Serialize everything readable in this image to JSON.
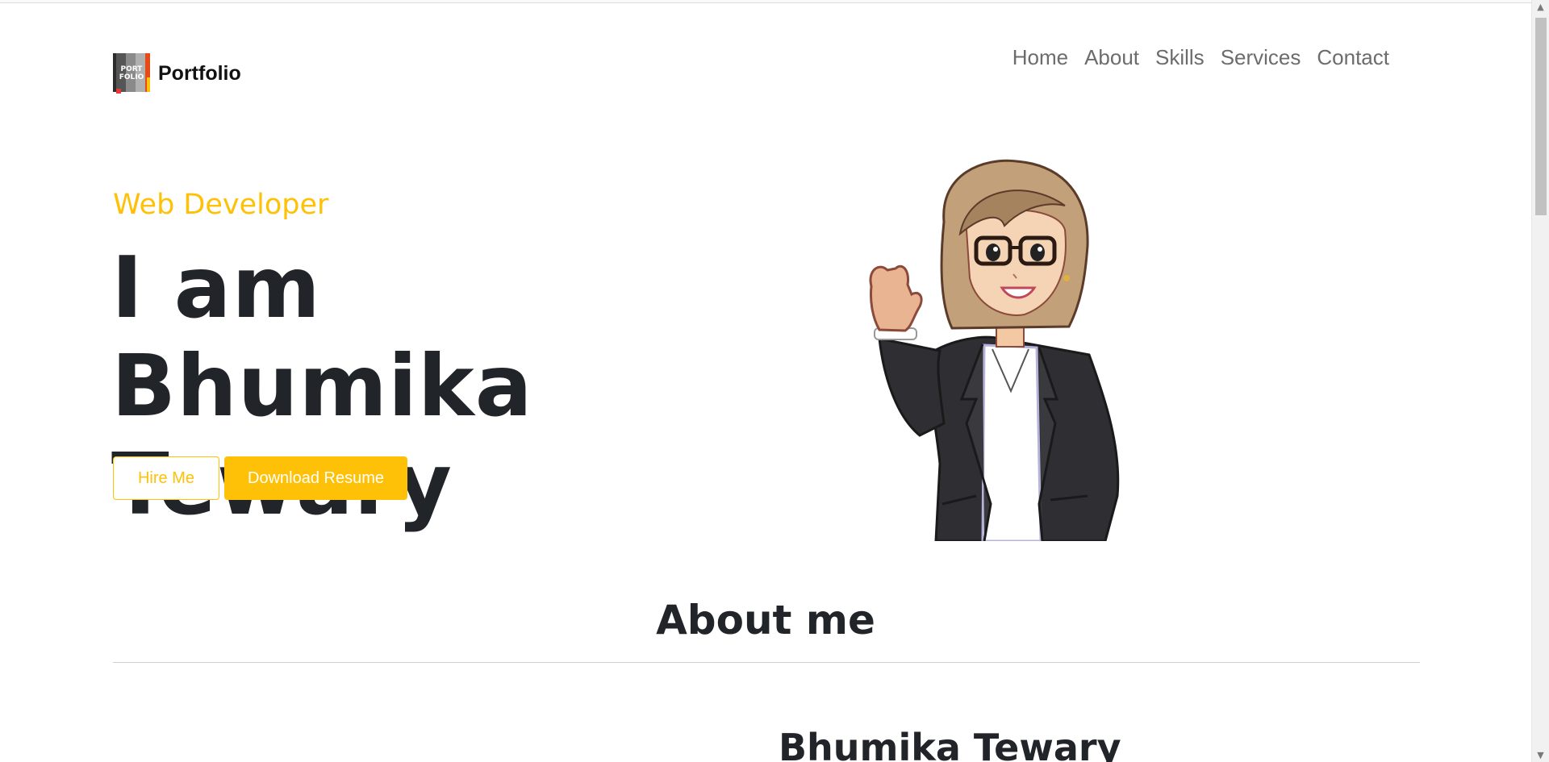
{
  "header": {
    "brand": {
      "name": "Portfolio",
      "logo_text_top": "PORT",
      "logo_text_bottom": "FOLIO"
    },
    "nav": [
      "Home",
      "About",
      "Skills",
      "Services",
      "Contact"
    ]
  },
  "hero": {
    "subtitle": "Web Developer",
    "title_line1": "I am Bhumika",
    "title_line2": "Tewary",
    "hire_button": "Hire Me",
    "resume_button": "Download Resume"
  },
  "about": {
    "title": "About me",
    "name": "Bhumika Tewary"
  },
  "colors": {
    "accent": "#ffc107",
    "text_dark": "#212529",
    "nav_text": "#6c6c6c"
  },
  "icons": {
    "scroll_up": "▲",
    "scroll_down": "▼"
  }
}
